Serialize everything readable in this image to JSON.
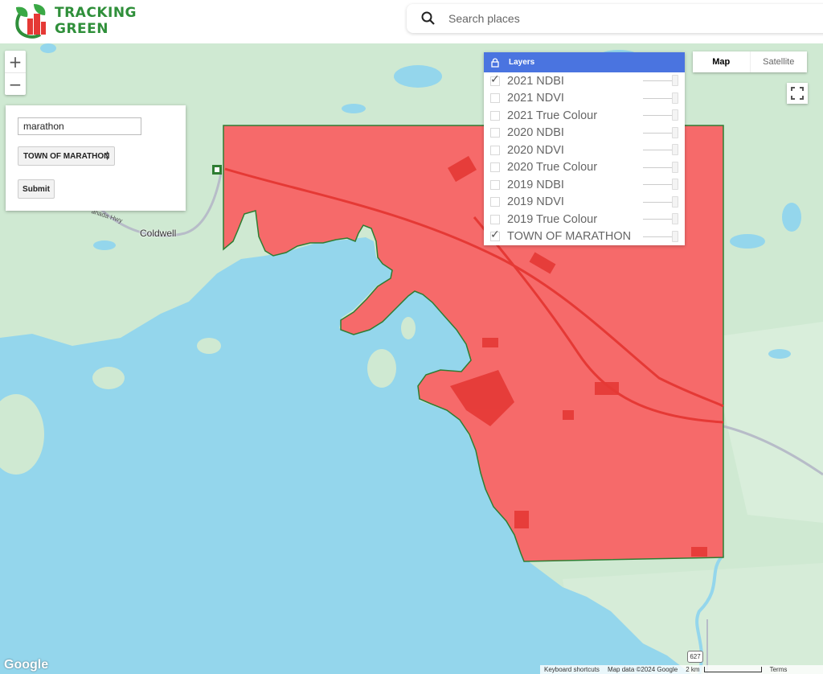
{
  "header": {
    "logo_line1": "TRACKING",
    "logo_line2": "GREEN",
    "search_placeholder": "Search places"
  },
  "map_controls": {
    "zoom_in": "+",
    "zoom_out": "−",
    "map_type_map": "Map",
    "map_type_satellite": "Satellite",
    "fullscreen_icon": "fullscreen-icon"
  },
  "query_panel": {
    "input_value": "marathon",
    "select_value": "TOWN OF MARATHON",
    "submit_label": "Submit"
  },
  "layers": {
    "title": "Layers",
    "items": [
      {
        "label": "2021 NDBI",
        "checked": true
      },
      {
        "label": "2021 NDVI",
        "checked": false
      },
      {
        "label": "2021 True Colour",
        "checked": false
      },
      {
        "label": "2020 NDBI",
        "checked": false
      },
      {
        "label": "2020 NDVI",
        "checked": false
      },
      {
        "label": "2020 True Colour",
        "checked": false
      },
      {
        "label": "2019 NDBI",
        "checked": false
      },
      {
        "label": "2019 NDVI",
        "checked": false
      },
      {
        "label": "2019 True Colour",
        "checked": false
      },
      {
        "label": "TOWN OF MARATHON",
        "checked": true
      }
    ]
  },
  "map_labels": {
    "place_coldwell": "Coldwell",
    "road_label": "anada Hwy",
    "route_shield": "627"
  },
  "footer": {
    "google": "Google",
    "keyboard": "Keyboard shortcuts",
    "map_data": "Map data ©2024 Google",
    "scale": "2 km",
    "terms": "Terms"
  },
  "colors": {
    "water": "#94d6ec",
    "land": "#cfe9d2",
    "ndbi_overlay": "#f66a6a",
    "boundary": "#2e7d32",
    "layers_header": "#4a74e0",
    "brand_green": "#2f8f3a"
  }
}
